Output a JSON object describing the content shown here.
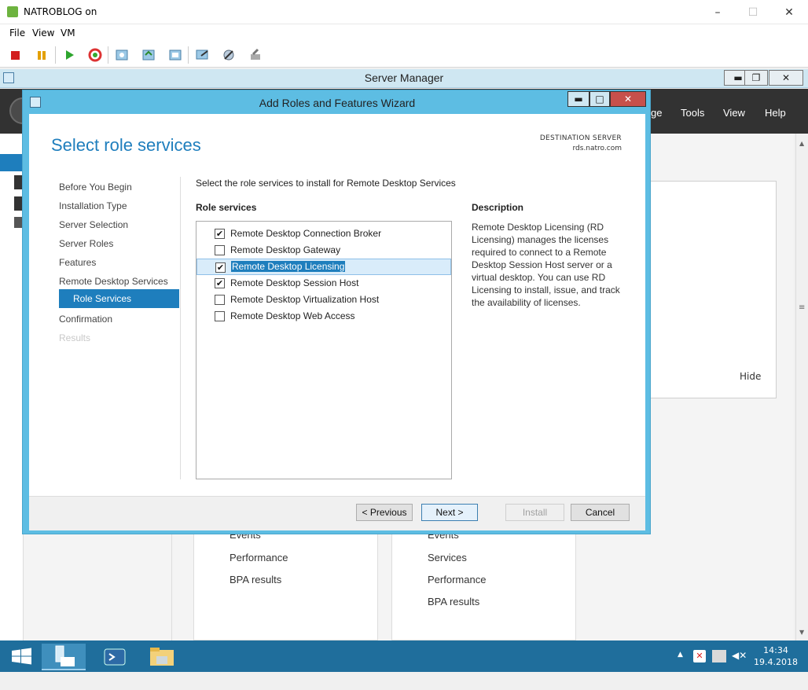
{
  "vm_window": {
    "title": "NATROBLOG on",
    "menu": [
      "File",
      "View",
      "VM"
    ],
    "controls": {
      "minimize": "–",
      "maximize": "☐",
      "close": "✕"
    }
  },
  "server_manager": {
    "title": "Server Manager",
    "controls": {
      "minimize": "▬",
      "maximize": "❐",
      "close": "✕"
    },
    "menu": [
      "ge",
      "Tools",
      "View",
      "Help"
    ],
    "panel_hide": "Hide",
    "tile_left": [
      "Events",
      "Performance",
      "BPA results"
    ],
    "tile_right": [
      "Events",
      "Services",
      "Performance",
      "BPA results"
    ]
  },
  "wizard": {
    "title": "Add Roles and Features Wizard",
    "heading": "Select role services",
    "destination_label": "DESTINATION SERVER",
    "destination_server": "rds.natro.com",
    "nav": [
      "Before You Begin",
      "Installation Type",
      "Server Selection",
      "Server Roles",
      "Features",
      "Remote Desktop Services",
      "Role Services",
      "Confirmation",
      "Results"
    ],
    "instruction": "Select the role services to install for Remote Desktop Services",
    "role_services_heading": "Role services",
    "role_services": [
      {
        "label": "Remote Desktop Connection Broker",
        "checked": true
      },
      {
        "label": "Remote Desktop Gateway",
        "checked": false
      },
      {
        "label": "Remote Desktop Licensing",
        "checked": true
      },
      {
        "label": "Remote Desktop Session Host",
        "checked": true
      },
      {
        "label": "Remote Desktop Virtualization Host",
        "checked": false
      },
      {
        "label": "Remote Desktop Web Access",
        "checked": false
      }
    ],
    "description_heading": "Description",
    "description": "Remote Desktop Licensing (RD Licensing) manages the licenses required to connect to a Remote Desktop Session Host server or a virtual desktop. You can use RD Licensing to install, issue, and track the availability of licenses.",
    "buttons": {
      "previous": "< Previous",
      "next": "Next >",
      "install": "Install",
      "cancel": "Cancel"
    },
    "controls": {
      "minimize": "▬",
      "maximize": "□",
      "close": "✕"
    }
  },
  "taskbar": {
    "time": "14:34",
    "date": "19.4.2018"
  },
  "colors": {
    "accent": "#1e7ebd",
    "wizard_frame": "#5dbde3",
    "taskbar": "#1f6e9c"
  }
}
